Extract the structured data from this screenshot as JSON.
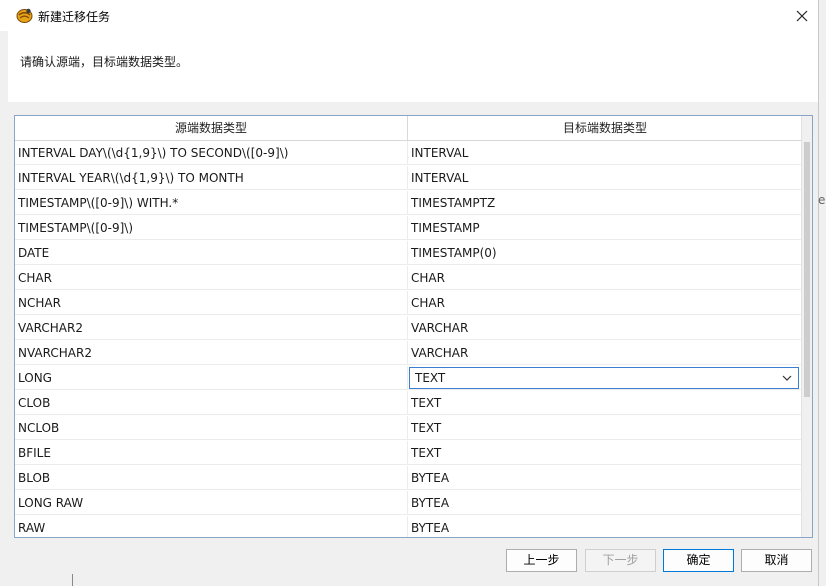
{
  "window": {
    "title": "新建迁移任务",
    "app_icon": "migration-app-icon",
    "close_icon": "close-icon"
  },
  "header": {
    "instruction": "请确认源端，目标端数据类型。"
  },
  "table": {
    "columns": [
      "源端数据类型",
      "目标端数据类型"
    ],
    "rows": [
      {
        "source": "INTERVAL DAY\\(\\d{1,9}\\) TO SECOND\\([0-9]\\)",
        "target": "INTERVAL"
      },
      {
        "source": "INTERVAL YEAR\\(\\d{1,9}\\) TO MONTH",
        "target": "INTERVAL"
      },
      {
        "source": "TIMESTAMP\\([0-9]\\) WITH.*",
        "target": "TIMESTAMPTZ"
      },
      {
        "source": "TIMESTAMP\\([0-9]\\)",
        "target": "TIMESTAMP"
      },
      {
        "source": "DATE",
        "target": "TIMESTAMP(0)"
      },
      {
        "source": "CHAR",
        "target": "CHAR"
      },
      {
        "source": "NCHAR",
        "target": "CHAR"
      },
      {
        "source": "VARCHAR2",
        "target": "VARCHAR"
      },
      {
        "source": "NVARCHAR2",
        "target": "VARCHAR"
      },
      {
        "source": "LONG",
        "target": "TEXT",
        "editing": true
      },
      {
        "source": "CLOB",
        "target": "TEXT"
      },
      {
        "source": "NCLOB",
        "target": "TEXT"
      },
      {
        "source": "BFILE",
        "target": "TEXT"
      },
      {
        "source": "BLOB",
        "target": "BYTEA"
      },
      {
        "source": "LONG RAW",
        "target": "BYTEA"
      },
      {
        "source": "RAW",
        "target": "BYTEA"
      }
    ]
  },
  "buttons": {
    "prev": "上一步",
    "next": "下一步",
    "ok": "确定",
    "cancel": "取消"
  },
  "edge_text": "e",
  "colors": {
    "accent": "#0078d7",
    "combo_border": "#3c7fd1",
    "table_border": "#8aa4c8"
  }
}
